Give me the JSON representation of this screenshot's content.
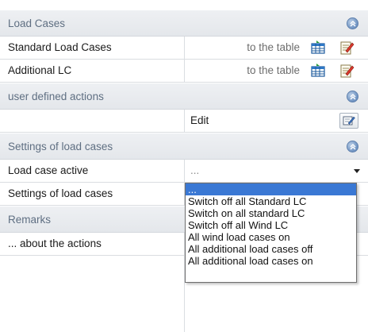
{
  "sections": {
    "load_cases": "Load Cases",
    "user_defined_actions": "user defined actions",
    "settings_of_load_cases": "Settings of load cases",
    "remarks": "Remarks"
  },
  "rows": {
    "standard_lc": {
      "label": "Standard Load Cases",
      "link": "to the table"
    },
    "additional_lc": {
      "label": "Additional LC",
      "link": "to the table"
    },
    "edit": {
      "value": "Edit"
    },
    "load_case_active": {
      "label": "Load case active",
      "value": "..."
    },
    "settings_lc": {
      "label": "Settings of load cases"
    },
    "about_actions": {
      "label": "... about the actions"
    }
  },
  "dropdown": {
    "options": [
      "...",
      "Switch off all Standard LC",
      "Switch on all standard LC",
      "Switch off all Wind LC",
      "All wind load cases on",
      "All additional load cases off",
      "All additional load cases on"
    ],
    "selected": "..."
  },
  "icons": {
    "collapse": "collapse-up-icon",
    "table": "table-icon",
    "notes": "notes-icon",
    "edit": "edit-icon"
  },
  "colors": {
    "section_bg": "#e6e9ed",
    "section_text": "#5f6f82",
    "selection": "#3a78d4"
  }
}
